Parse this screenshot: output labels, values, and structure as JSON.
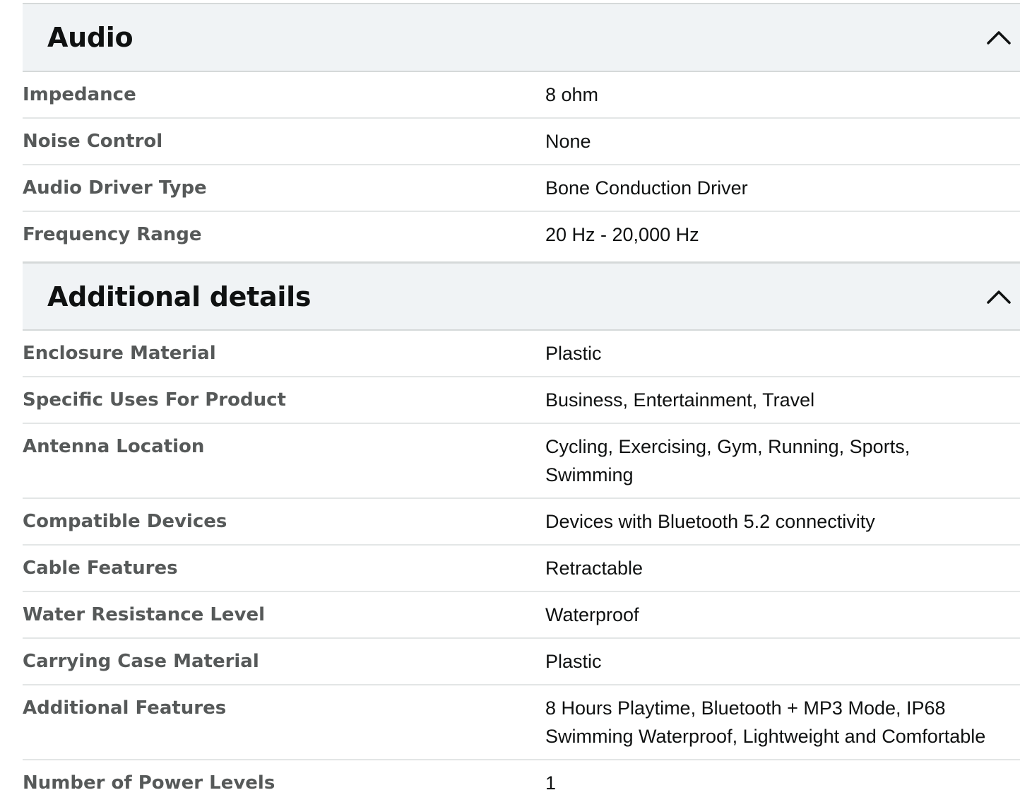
{
  "sections": [
    {
      "title": "Audio",
      "toggle_icon": "chevron-up-icon",
      "rows": [
        {
          "label": "Impedance",
          "value": "8 ohm"
        },
        {
          "label": "Noise Control",
          "value": "None"
        },
        {
          "label": "Audio Driver Type",
          "value": "Bone Conduction Driver"
        },
        {
          "label": "Frequency Range",
          "value": "20 Hz - 20,000 Hz"
        }
      ]
    },
    {
      "title": "Additional details",
      "toggle_icon": "chevron-up-icon",
      "rows": [
        {
          "label": "Enclosure Material",
          "value": "Plastic"
        },
        {
          "label": "Specific Uses For Product",
          "value": "Business, Entertainment, Travel"
        },
        {
          "label": "Antenna Location",
          "value": "Cycling, Exercising, Gym, Running, Sports, Swimming"
        },
        {
          "label": "Compatible Devices",
          "value": "Devices with Bluetooth 5.2 connectivity"
        },
        {
          "label": "Cable Features",
          "value": "Retractable"
        },
        {
          "label": "Water Resistance Level",
          "value": "Waterproof"
        },
        {
          "label": "Carrying Case Material",
          "value": "Plastic"
        },
        {
          "label": "Additional Features",
          "value": "8 Hours Playtime, Bluetooth + MP3 Mode, IP68 Swimming Waterproof, Lightweight and Comfortable"
        },
        {
          "label": "Number of Power Levels",
          "value": "1"
        }
      ]
    }
  ],
  "colors": {
    "header_bg": "#f0f3f5",
    "label_text": "#565959",
    "value_text": "#0f1111",
    "divider": "#e3e6e6"
  }
}
